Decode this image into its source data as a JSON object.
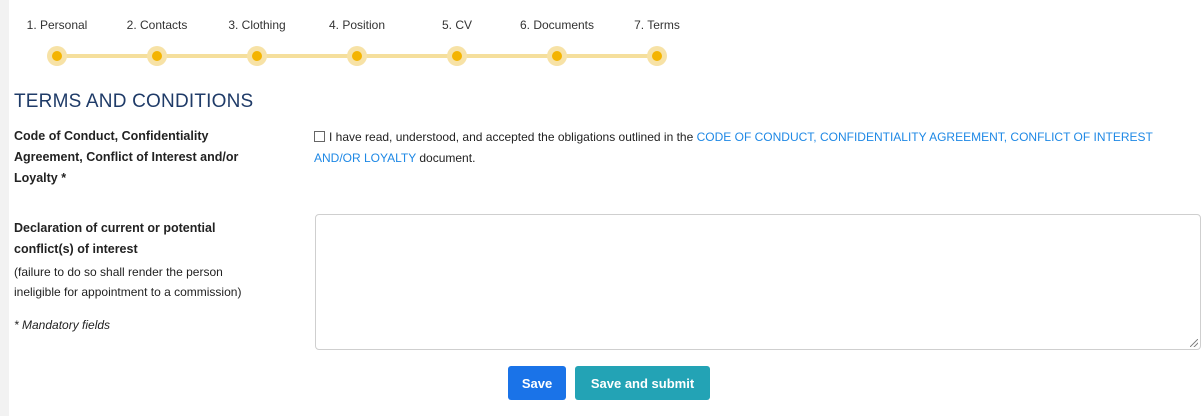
{
  "steps": [
    {
      "label": "1. Personal"
    },
    {
      "label": "2. Contacts"
    },
    {
      "label": "3. Clothing"
    },
    {
      "label": "4. Position"
    },
    {
      "label": "5. CV"
    },
    {
      "label": "6. Documents"
    },
    {
      "label": "7. Terms"
    }
  ],
  "section_title": "TERMS AND CONDITIONS",
  "code_of_conduct": {
    "label_lines": [
      "Code of Conduct, Confidentiality",
      "Agreement, Conflict of Interest and/or",
      "Loyalty *"
    ],
    "checkbox_text_before": "I have read, understood, and accepted the obligations outlined in the ",
    "link_text": "CODE OF CONDUCT, CONFIDENTIALITY AGREEMENT, CONFLICT OF INTEREST AND/OR LOYALTY",
    "checkbox_text_after": " document.",
    "checked": false
  },
  "declaration": {
    "label_lines": [
      "Declaration of current or potential",
      "conflict(s) of interest"
    ],
    "note_lines": [
      "(failure to do so shall render the person",
      "ineligible for appointment to a commission)"
    ],
    "value": ""
  },
  "mandatory_note": "* Mandatory fields",
  "buttons": {
    "save": "Save",
    "save_and_submit": "Save and submit"
  },
  "colors": {
    "step_dot": "#f4b400",
    "step_track": "#f5df9c",
    "title": "#1f3b68",
    "link": "#1e88e5",
    "save_button": "#1a73e8",
    "submit_button": "#23a3b5"
  }
}
